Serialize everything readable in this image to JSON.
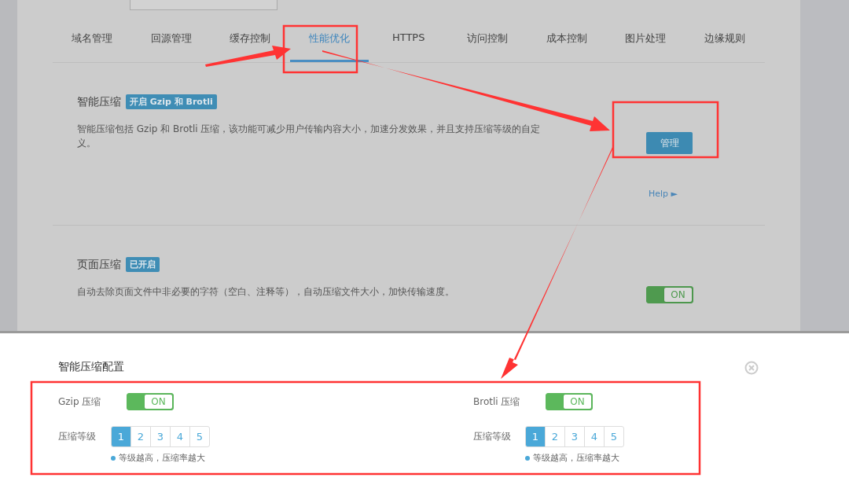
{
  "tabs": [
    {
      "label": "域名管理",
      "selected": false
    },
    {
      "label": "回源管理",
      "selected": false
    },
    {
      "label": "缓存控制",
      "selected": false
    },
    {
      "label": "性能优化",
      "selected": true
    },
    {
      "label": "HTTPS",
      "selected": false
    },
    {
      "label": "访问控制",
      "selected": false
    },
    {
      "label": "成本控制",
      "selected": false
    },
    {
      "label": "图片处理",
      "selected": false
    },
    {
      "label": "边缘规则",
      "selected": false
    }
  ],
  "sections": [
    {
      "title": "智能压缩",
      "badge": "开启 Gzip 和 Brotli",
      "description": "智能压缩包括 Gzip 和 Brotli 压缩，该功能可减少用户传输内容大小，加速分发效果，并且支持压缩等级的自定义。",
      "control": {
        "kind": "button",
        "label": "管理"
      },
      "help": "Help ►"
    },
    {
      "title": "页面压缩",
      "badge": "已开启",
      "description": "自动去除页面文件中非必要的字符（空白、注释等），自动压缩文件大小，加快传输速度。",
      "control": {
        "kind": "toggle",
        "on": true,
        "label": "ON"
      }
    }
  ],
  "modal": {
    "title": "智能压缩配置",
    "groups": [
      {
        "label": "Gzip 压缩",
        "on": true,
        "toggle_text": "ON",
        "level_label": "压缩等级",
        "levels": [
          {
            "label": "1",
            "selected": true
          },
          {
            "label": "2",
            "selected": false
          },
          {
            "label": "3",
            "selected": false
          },
          {
            "label": "4",
            "selected": false
          },
          {
            "label": "5",
            "selected": false
          }
        ],
        "hint": "等级越高，压缩率越大"
      },
      {
        "label": "Brotli 压缩",
        "on": true,
        "toggle_text": "ON",
        "level_label": "压缩等级",
        "levels": [
          {
            "label": "1",
            "selected": true
          },
          {
            "label": "2",
            "selected": false
          },
          {
            "label": "3",
            "selected": false
          },
          {
            "label": "4",
            "selected": false
          },
          {
            "label": "5",
            "selected": false
          }
        ],
        "hint": "等级越高，压缩率越大"
      }
    ]
  }
}
